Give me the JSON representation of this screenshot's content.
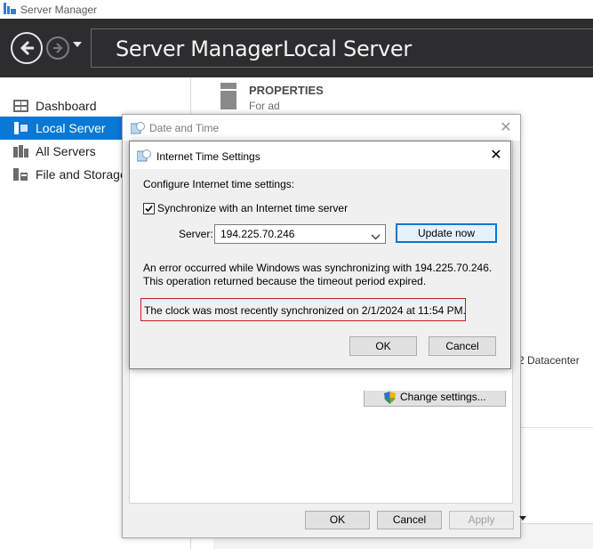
{
  "window": {
    "title": "Server Manager"
  },
  "header": {
    "breadcrumb": [
      "Server Manager",
      "Local Server"
    ]
  },
  "sidebar": {
    "items": [
      {
        "label": "Dashboard",
        "icon": "dashboard-icon",
        "active": false
      },
      {
        "label": "Local Server",
        "icon": "local-server-icon",
        "active": true
      },
      {
        "label": "All Servers",
        "icon": "all-servers-icon",
        "active": false
      },
      {
        "label": "File and Storage",
        "icon": "file-storage-icon",
        "active": false
      }
    ]
  },
  "main": {
    "properties_title": "PROPERTIES",
    "properties_subtitle": "For ad",
    "os_fragment": "2 Datacenter"
  },
  "date_time_dialog": {
    "title": "Date and Time",
    "change_settings_label": "Change settings...",
    "buttons": {
      "ok": "OK",
      "cancel": "Cancel",
      "apply": "Apply"
    }
  },
  "internet_time_dialog": {
    "title": "Internet Time Settings",
    "configure_label": "Configure Internet time settings:",
    "sync_checkbox_label": "Synchronize with an Internet time server",
    "sync_checked": true,
    "server_label": "Server:",
    "server_value": "194.225.70.246",
    "update_button": "Update now",
    "error_line1": "An error occurred while Windows was synchronizing with 194.225.70.246.",
    "error_line2": "This operation returned because the timeout period expired.",
    "last_sync_message": "The clock was most recently synchronized on 2/1/2024 at 11:54 PM.",
    "ok_button": "OK",
    "cancel_button": "Cancel"
  },
  "colors": {
    "header_bg": "#2d2d30",
    "sidebar_active": "#0b78d4",
    "highlight_border": "#c41e1e",
    "default_button_border": "#0078d7"
  }
}
